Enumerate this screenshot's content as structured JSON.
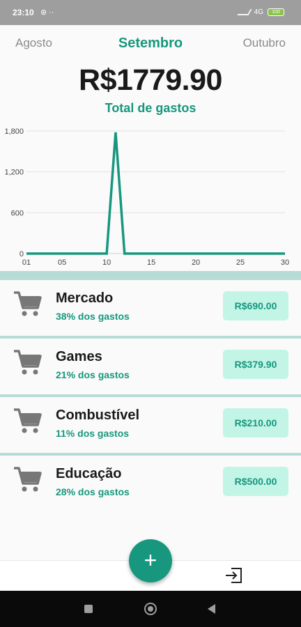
{
  "status_bar": {
    "time": "23:10",
    "left_icons": "⊛ ··",
    "network": "4G",
    "battery": "100"
  },
  "month_nav": {
    "previous": "Agosto",
    "current": "Setembro",
    "next": "Outubro"
  },
  "summary": {
    "total": "R$1779.90",
    "total_label": "Total de gastos"
  },
  "chart_data": {
    "type": "line",
    "x_ticks": [
      "01",
      "05",
      "10",
      "15",
      "20",
      "25",
      "30"
    ],
    "y_ticks": [
      "0",
      "600",
      "1,200",
      "1,800"
    ],
    "ylim": [
      0,
      1800
    ],
    "xlim": [
      1,
      30
    ],
    "grid": true,
    "series": [
      {
        "x": [
          1,
          10,
          11,
          12,
          30
        ],
        "values": [
          0,
          0,
          1779.9,
          0,
          0
        ]
      }
    ],
    "color": "#17977e"
  },
  "expenses": [
    {
      "name": "Mercado",
      "percent": "38% dos gastos",
      "amount": "R$690.00",
      "icon": "cart-icon"
    },
    {
      "name": "Games",
      "percent": "21% dos gastos",
      "amount": "R$379.90",
      "icon": "cart-icon"
    },
    {
      "name": "Combustível",
      "percent": "11% dos gastos",
      "amount": "R$210.00",
      "icon": "cart-icon"
    },
    {
      "name": "Educação",
      "percent": "28% dos gastos",
      "amount": "R$500.00",
      "icon": "cart-icon"
    }
  ],
  "actions": {
    "add": "+",
    "logout_icon": "logout-icon"
  },
  "colors": {
    "accent": "#17977e",
    "badge_bg": "#c3f5e6",
    "divider": "#b6dcd5"
  }
}
